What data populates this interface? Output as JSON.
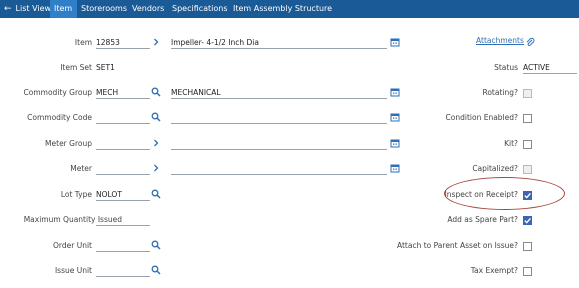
{
  "tabs": [
    {
      "label": "List View",
      "active": false
    },
    {
      "label": "Item",
      "active": true
    },
    {
      "label": "Storerooms",
      "active": false
    },
    {
      "label": "Vendors",
      "active": false
    },
    {
      "label": "Specifications",
      "active": false
    },
    {
      "label": "Item Assembly Structure",
      "active": false
    }
  ],
  "left_fields": {
    "item": {
      "label": "Item",
      "value": "12853",
      "description": "Impeller- 4-1/2 Inch Dia"
    },
    "item_set": {
      "label": "Item Set",
      "value": "SET1"
    },
    "commodity_group": {
      "label": "Commodity Group",
      "value": "MECH",
      "description": "MECHANICAL"
    },
    "commodity_code": {
      "label": "Commodity Code",
      "value": ""
    },
    "meter_group": {
      "label": "Meter Group",
      "value": ""
    },
    "meter": {
      "label": "Meter",
      "value": ""
    },
    "lot_type": {
      "label": "Lot Type",
      "value": "NOLOT"
    },
    "max_qty_issued": {
      "label": "Maximum Quantity Issued",
      "value": ""
    },
    "order_unit": {
      "label": "Order Unit",
      "value": ""
    },
    "issue_unit": {
      "label": "Issue Unit",
      "value": ""
    }
  },
  "right_fields": {
    "attachments": {
      "label": "Attachments"
    },
    "status": {
      "label": "Status",
      "value": "ACTIVE"
    },
    "rotating": {
      "label": "Rotating?",
      "checked": false
    },
    "condition_enabled": {
      "label": "Condition Enabled?",
      "checked": false
    },
    "kit": {
      "label": "Kit?",
      "checked": false
    },
    "capitalized": {
      "label": "Capitalized?",
      "checked": false
    },
    "inspect_on_receipt": {
      "label": "Inspect on Receipt?",
      "checked": true
    },
    "add_as_spare_part": {
      "label": "Add as Spare Part?",
      "checked": true
    },
    "attach_to_parent": {
      "label": "Attach to Parent Asset on Issue?",
      "checked": false
    },
    "tax_exempt": {
      "label": "Tax Exempt?",
      "checked": false
    }
  },
  "colors": {
    "tabbar": "#1a5a96",
    "active_tab": "#2f80c9",
    "checkbox_checked": "#3d63b3",
    "highlight_ellipse": "#a3493e"
  },
  "icons": [
    "arrow-left-icon",
    "chevron-right-icon",
    "search-icon",
    "calendar-icon",
    "paperclip-icon"
  ]
}
